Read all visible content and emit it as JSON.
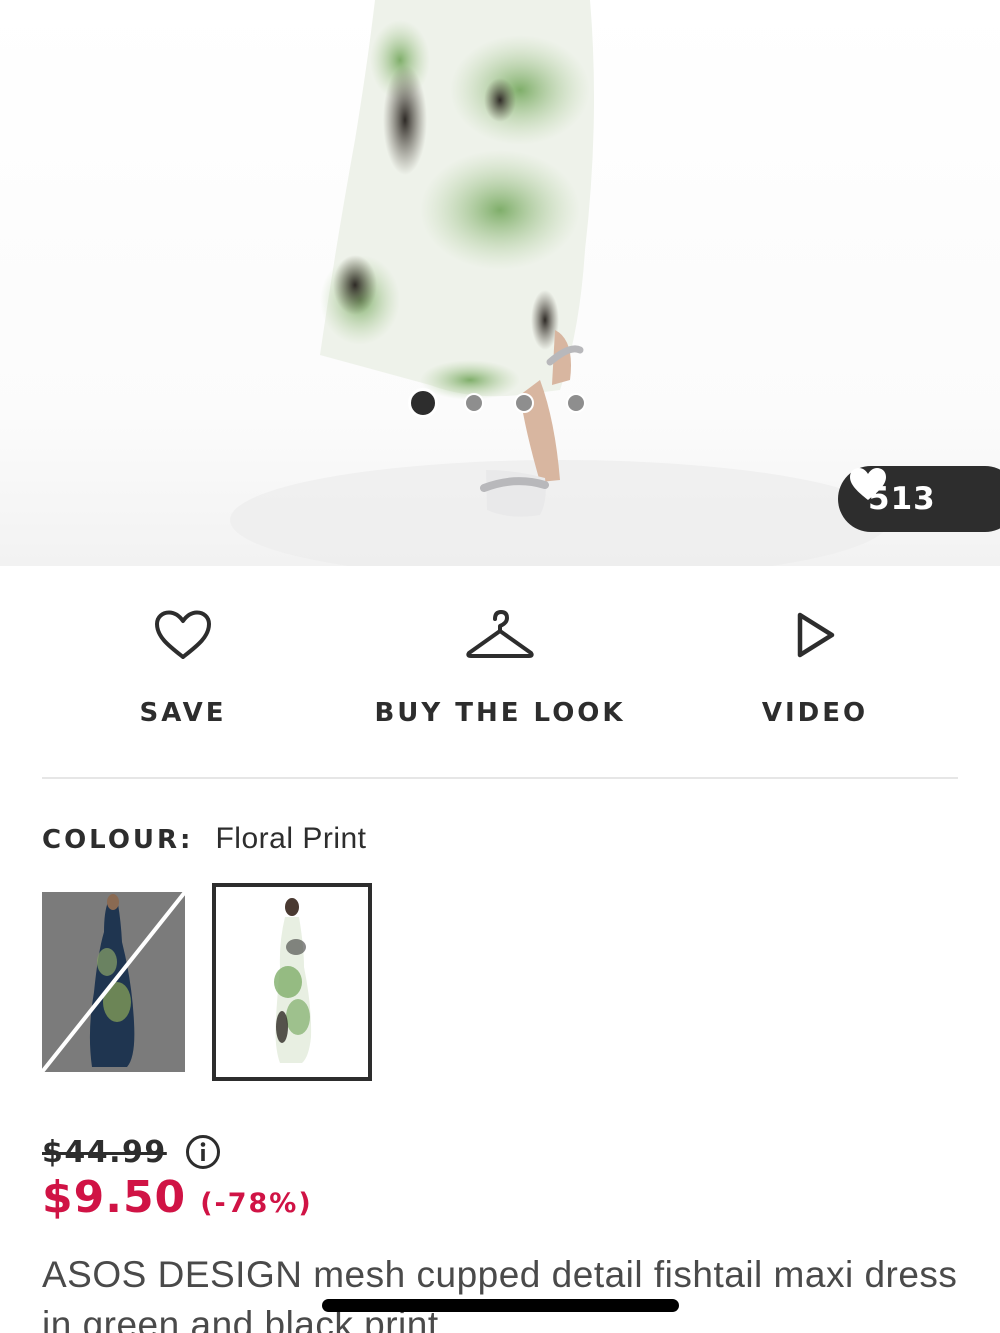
{
  "gallery": {
    "dot_count": 4,
    "active_dot": 1,
    "likes": "513"
  },
  "actions": {
    "save_label": "SAVE",
    "buy_the_look_label": "BUY THE LOOK",
    "video_label": "VIDEO",
    "icons": [
      "heart-icon",
      "hanger-icon",
      "play-icon"
    ]
  },
  "colour": {
    "label": "COLOUR:",
    "value": "Floral Print",
    "swatches": [
      {
        "name": "blue-print",
        "available": false
      },
      {
        "name": "floral-print",
        "available": true,
        "selected": true
      }
    ]
  },
  "price": {
    "was": "$44.99",
    "now": "$9.50",
    "discount": "(-78%)",
    "sale_color": "#d01345"
  },
  "product": {
    "title": "ASOS DESIGN mesh cupped detail fishtail maxi dress in green and black print"
  }
}
